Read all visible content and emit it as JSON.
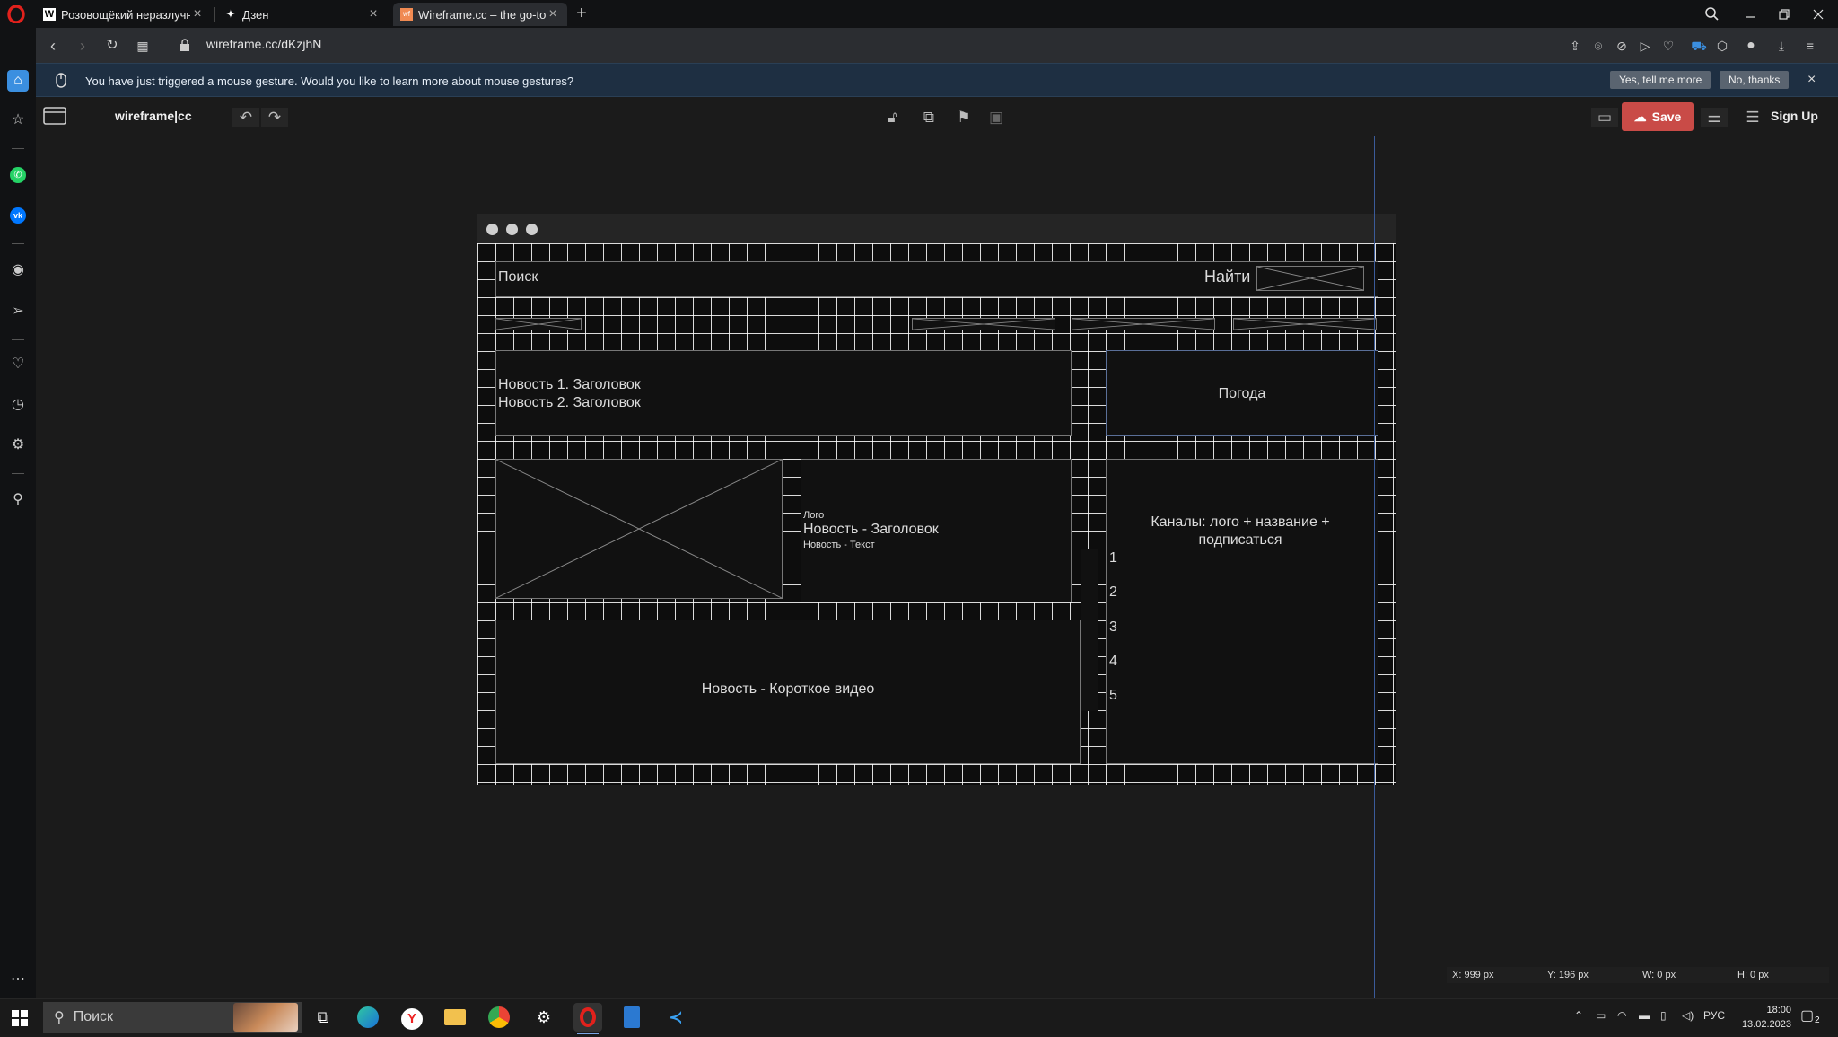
{
  "browser": {
    "tabs": [
      {
        "label": "Розовощёкий неразлучник",
        "favicon": "W"
      },
      {
        "label": "Дзен",
        "favicon": "✦"
      },
      {
        "label": "Wireframe.cc – the go-to free",
        "favicon": "wf"
      }
    ],
    "new_tab_symbol": "+",
    "url": "wireframe.cc/dKzjhN"
  },
  "notification": {
    "message": "You have just triggered a mouse gesture. Would you like to learn more about mouse gestures?",
    "yes_label": "Yes, tell me more",
    "no_label": "No, thanks",
    "close_symbol": "×"
  },
  "app": {
    "logo": "wireframe|cc",
    "save_label": "Save",
    "signup_label": "Sign Up"
  },
  "wireframe": {
    "search_label": "Поиск",
    "find_label": "Найти",
    "news_line1": "Новость 1. Заголовок",
    "news_line2": "Новость 2. Заголовок",
    "weather": "Погода",
    "logo_small": "Лого",
    "news_title": "Новость - Заголовок",
    "news_text": "Новость - Текст",
    "channels_line1": "Каналы: лого  + название +",
    "channels_line2": "подписаться",
    "numbers": [
      "1",
      "2",
      "3",
      "4",
      "5"
    ],
    "video": "Новость - Короткое видео"
  },
  "status": {
    "x": "X: 999 px",
    "y": "Y: 196 px",
    "w": "W: 0 px",
    "h": "H: 0 px"
  },
  "taskbar": {
    "search_placeholder": "Поиск",
    "lang": "РУС",
    "time": "18:00",
    "date": "13.02.2023",
    "notif_count": "2"
  },
  "colors": {
    "save": "#c94b47",
    "notification_bg": "#1e2f42",
    "guide_line": "#3b5b9a"
  }
}
